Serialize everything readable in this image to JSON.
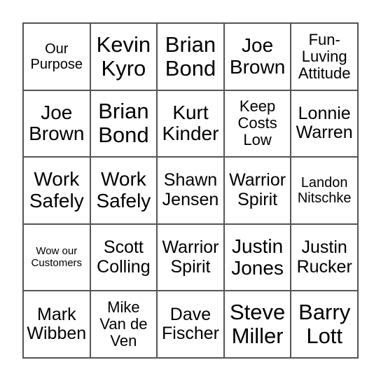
{
  "board": {
    "cells": [
      {
        "text": "Our Purpose",
        "size": "s20"
      },
      {
        "text": "Kevin Kyro",
        "size": "s30"
      },
      {
        "text": "Brian Bond",
        "size": "s30"
      },
      {
        "text": "Joe Brown",
        "size": "s28"
      },
      {
        "text": "Fun-Luving Attitude",
        "size": "s22"
      },
      {
        "text": "Joe Brown",
        "size": "s28"
      },
      {
        "text": "Brian Bond",
        "size": "s30"
      },
      {
        "text": "Kurt Kinder",
        "size": "s28"
      },
      {
        "text": "Keep Costs Low",
        "size": "s22"
      },
      {
        "text": "Lonnie Warren",
        "size": "s24"
      },
      {
        "text": "Work Safely",
        "size": "s28"
      },
      {
        "text": "Work Safely",
        "size": "s28"
      },
      {
        "text": "Shawn Jensen",
        "size": "s24"
      },
      {
        "text": "Warrior Spirit",
        "size": "s24"
      },
      {
        "text": "Landon Nitschke",
        "size": "s20"
      },
      {
        "text": "Wow our Customers",
        "size": "s14"
      },
      {
        "text": "Scott Colling",
        "size": "s24"
      },
      {
        "text": "Warrior Spirit",
        "size": "s24"
      },
      {
        "text": "Justin Jones",
        "size": "s28"
      },
      {
        "text": "Justin Rucker",
        "size": "s24"
      },
      {
        "text": "Mark Wibben",
        "size": "s24"
      },
      {
        "text": "Mike Van de Ven",
        "size": "s22"
      },
      {
        "text": "Dave Fischer",
        "size": "s24"
      },
      {
        "text": "Steve Miller",
        "size": "s30"
      },
      {
        "text": "Barry Lott",
        "size": "s30"
      }
    ]
  }
}
